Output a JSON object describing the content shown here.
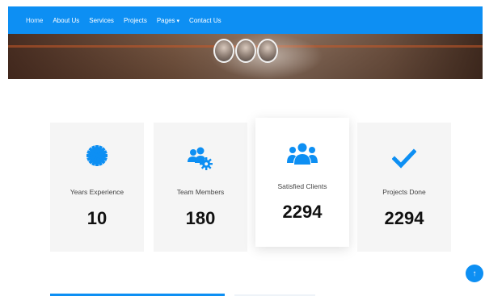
{
  "nav": {
    "items": [
      {
        "label": "Home",
        "active": true,
        "dropdown": false
      },
      {
        "label": "About Us",
        "active": false,
        "dropdown": false
      },
      {
        "label": "Services",
        "active": false,
        "dropdown": false
      },
      {
        "label": "Projects",
        "active": false,
        "dropdown": false
      },
      {
        "label": "Pages",
        "active": false,
        "dropdown": true
      },
      {
        "label": "Contact Us",
        "active": false,
        "dropdown": false
      }
    ],
    "dropdown_caret": "▾"
  },
  "stats": [
    {
      "icon": "gear-icon",
      "label": "Years Experience",
      "value": "10"
    },
    {
      "icon": "team-icon",
      "label": "Team Members",
      "value": "180"
    },
    {
      "icon": "users-icon",
      "label": "Satisfied Clients",
      "value": "2294"
    },
    {
      "icon": "check-icon",
      "label": "Projects Done",
      "value": "2294"
    }
  ],
  "back_to_top": {
    "icon": "arrow-up-icon",
    "glyph": "↑"
  },
  "colors": {
    "primary": "#0d8ff3",
    "card_bg": "#f5f5f5",
    "text_dark": "#111111"
  }
}
